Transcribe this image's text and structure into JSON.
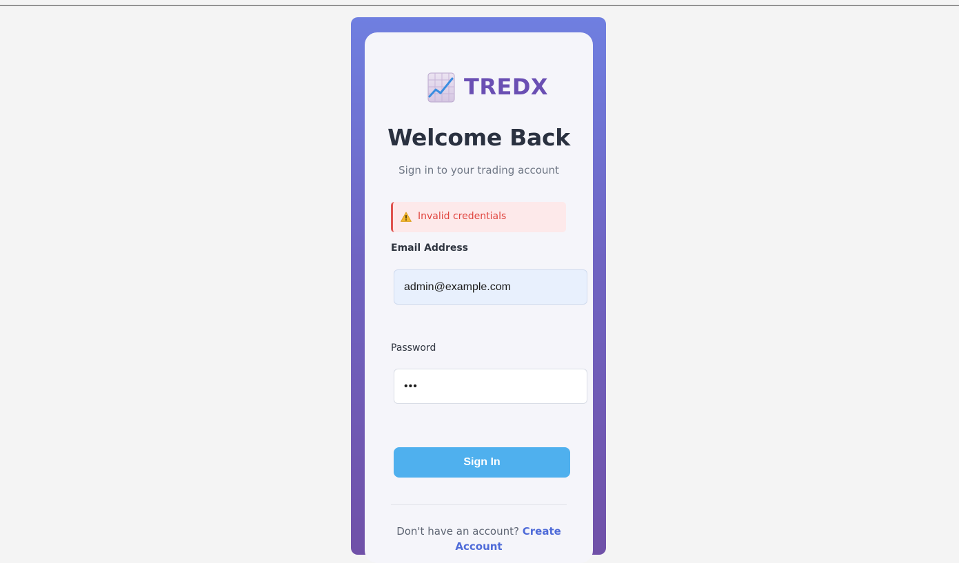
{
  "brand": {
    "name": "TREDX",
    "logo_icon": "chart-increasing-icon"
  },
  "login": {
    "title": "Welcome Back",
    "subtitle": "Sign in to your trading account",
    "error": {
      "icon": "warning-icon",
      "message": "Invalid credentials"
    },
    "email": {
      "label": "Email Address",
      "value": "admin@example.com"
    },
    "password": {
      "label": "Password",
      "value": "•••"
    },
    "submit_label": "Sign In",
    "footer": {
      "prompt": "Don't have an account?",
      "link_label": "Create Account"
    }
  },
  "colors": {
    "background": "#f4f4f4",
    "brand": "#6a4fb3",
    "frame_gradient": [
      "#6f7fe0",
      "#7051a8"
    ],
    "button": "#4fb0ee",
    "error": "#e0453f",
    "link": "#4f6bd8"
  }
}
